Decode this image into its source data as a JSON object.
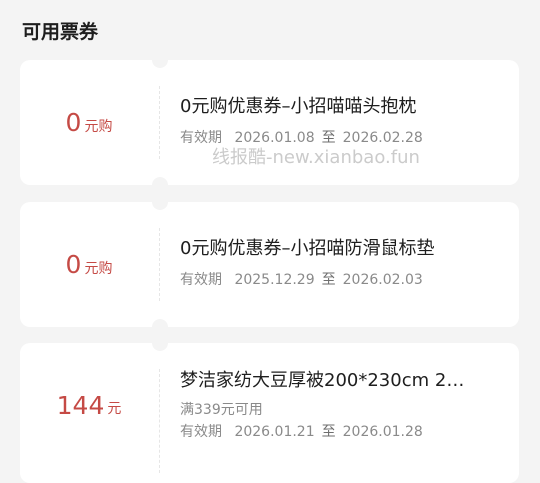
{
  "section_title": "可用票券",
  "watermark": "线报酷-new.xianbao.fun",
  "coupons": [
    {
      "price": "0",
      "unit": "元购",
      "title": "0元购优惠券–小招喵喵头抱枕",
      "condition": "",
      "validity_label": "有效期",
      "start": "2026.01.08",
      "to": "至",
      "end": "2026.02.28"
    },
    {
      "price": "0",
      "unit": "元购",
      "title": "0元购优惠券–小招喵防滑鼠标垫",
      "condition": "",
      "validity_label": "有效期",
      "start": "2025.12.29",
      "to": "至",
      "end": "2026.02.03"
    },
    {
      "price": "144",
      "unit": "元",
      "title": "梦洁家纺大豆厚被200*230cm 2…",
      "condition": "满339元可用",
      "validity_label": "有效期",
      "start": "2026.01.21",
      "to": "至",
      "end": "2026.01.28"
    }
  ]
}
